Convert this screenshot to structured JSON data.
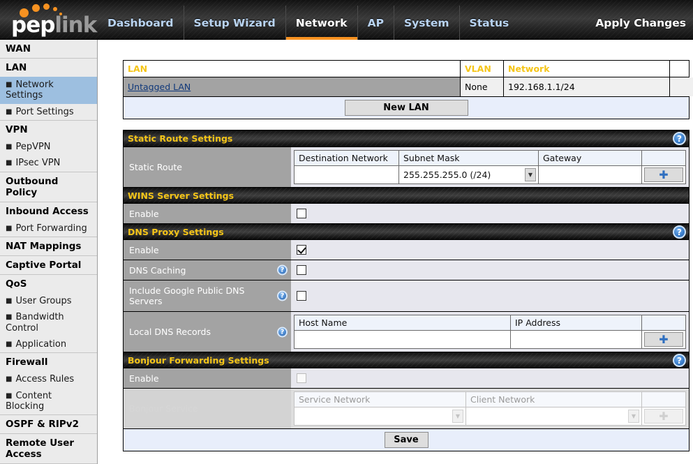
{
  "brand": {
    "name_part1": "pep",
    "name_part2": "link"
  },
  "nav": {
    "tabs": [
      {
        "label": "Dashboard",
        "active": false
      },
      {
        "label": "Setup Wizard",
        "active": false
      },
      {
        "label": "Network",
        "active": true
      },
      {
        "label": "AP",
        "active": false
      },
      {
        "label": "System",
        "active": false
      },
      {
        "label": "Status",
        "active": false
      }
    ],
    "apply_changes": "Apply Changes"
  },
  "sidebar": {
    "groups": [
      {
        "head": "WAN",
        "items": []
      },
      {
        "head": "LAN",
        "items": [
          {
            "label": "Network Settings",
            "selected": true
          },
          {
            "label": "Port Settings",
            "selected": false
          }
        ]
      },
      {
        "head": "VPN",
        "items": [
          {
            "label": "PepVPN",
            "selected": false
          },
          {
            "label": "IPsec VPN",
            "selected": false
          }
        ]
      },
      {
        "head": "Outbound Policy",
        "items": []
      },
      {
        "head": "Inbound Access",
        "items": [
          {
            "label": "Port Forwarding",
            "selected": false
          }
        ]
      },
      {
        "head": "NAT Mappings",
        "items": []
      },
      {
        "head": "Captive Portal",
        "items": []
      },
      {
        "head": "QoS",
        "items": [
          {
            "label": "User Groups",
            "selected": false
          },
          {
            "label": "Bandwidth Control",
            "selected": false
          },
          {
            "label": "Application",
            "selected": false
          }
        ]
      },
      {
        "head": "Firewall",
        "items": [
          {
            "label": "Access Rules",
            "selected": false
          },
          {
            "label": "Content Blocking",
            "selected": false
          }
        ]
      },
      {
        "head": "OSPF & RIPv2",
        "items": []
      },
      {
        "head": "Remote User Access",
        "items": []
      }
    ]
  },
  "lan_table": {
    "headers": {
      "lan": "LAN",
      "vlan": "VLAN",
      "network": "Network",
      "blank": ""
    },
    "rows": [
      {
        "lan": "Untagged LAN",
        "vlan": "None",
        "network": "192.168.1.1/24"
      }
    ],
    "new_lan_button": "New LAN",
    "help": "?"
  },
  "static_route": {
    "section_title": "Static Route Settings",
    "row_label": "Static Route",
    "columns": {
      "destination": "Destination Network",
      "subnet": "Subnet Mask",
      "gateway": "Gateway"
    },
    "destination_value": "",
    "subnet_value": "255.255.255.0 (/24)",
    "gateway_value": "",
    "add_button": "+",
    "help": "?"
  },
  "wins": {
    "section_title": "WINS Server Settings",
    "enable_label": "Enable",
    "enable_checked": false
  },
  "dns_proxy": {
    "section_title": "DNS Proxy Settings",
    "help": "?",
    "enable_label": "Enable",
    "enable_checked": true,
    "caching_label": "DNS Caching",
    "caching_checked": false,
    "google_label": "Include Google Public DNS Servers",
    "google_checked": false,
    "local_records_label": "Local DNS Records",
    "local_columns": {
      "host": "Host Name",
      "ip": "IP Address"
    },
    "local_host_value": "",
    "local_ip_value": "",
    "add_button": "+"
  },
  "bonjour": {
    "section_title": "Bonjour Forwarding Settings",
    "help": "?",
    "enable_label": "Enable",
    "enable_checked": false,
    "service_label": "Bonjour Service",
    "columns": {
      "service_network": "Service Network",
      "client_network": "Client Network"
    },
    "service_value": "",
    "client_value": "",
    "add_button": "+"
  },
  "footer": {
    "save_button": "Save"
  },
  "colors": {
    "accent_orange": "#f79221",
    "section_yellow": "#f5c518",
    "sidebar_selected": "#9dbfe0",
    "label_gray": "#a3a3a3",
    "value_bg": "#e7e7ee"
  }
}
